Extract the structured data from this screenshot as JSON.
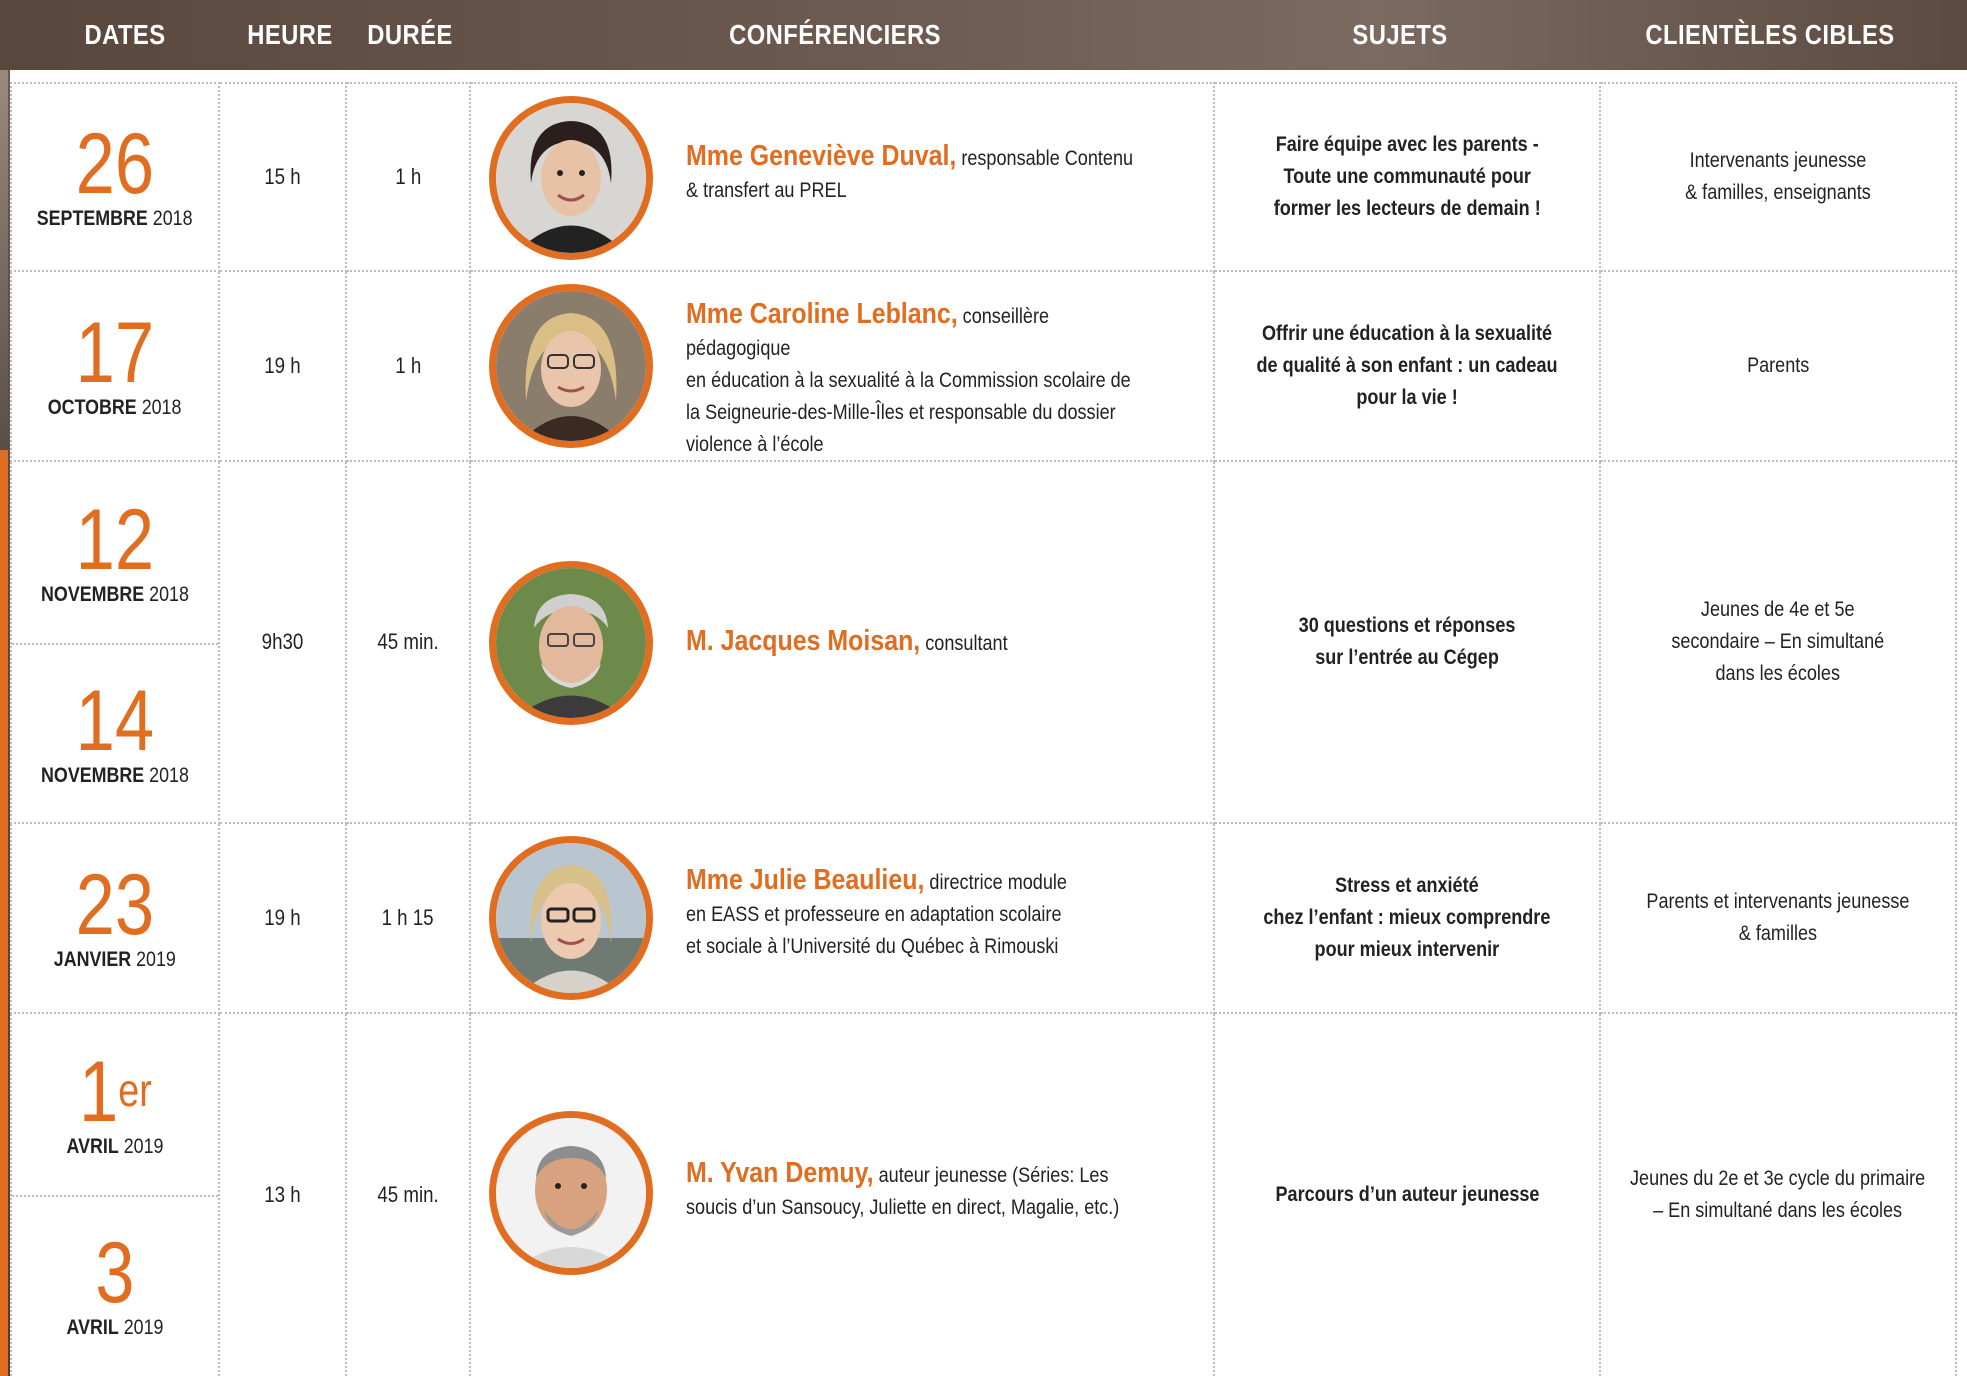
{
  "header": {
    "dates": "DATES",
    "heure": "HEURE",
    "duree": "DURÉE",
    "conferenciers": "CONFÉRENCIERS",
    "sujets": "SUJETS",
    "clienteles": "CLIENTÈLES CIBLES"
  },
  "colors": {
    "accent": "#e06d20",
    "header_bg": "#5f4d44"
  },
  "rows": [
    {
      "dates": [
        {
          "day": "26",
          "month": "SEPTEMBRE",
          "year": "2018"
        }
      ],
      "heure": "15 h",
      "duree": "1 h",
      "speaker_name": "Mme Geneviève Duval,",
      "speaker_role": "responsable Contenu",
      "speaker_role2": "& transfert au PREL",
      "subject_lines": [
        "Faire équipe avec les parents -",
        "Toute une communauté pour",
        "former  les lecteurs de demain !"
      ],
      "target_lines": [
        "Intervenants jeunesse",
        "& familles, enseignants"
      ]
    },
    {
      "dates": [
        {
          "day": "17",
          "month": "OCTOBRE",
          "year": "2018"
        }
      ],
      "heure": "19 h",
      "duree": "1 h",
      "speaker_name": "Mme Caroline Leblanc,",
      "speaker_role": "conseillère pédagogique",
      "speaker_role2": "en éducation à la sexualité à la Commission scolaire de",
      "speaker_role3": "la Seigneurie-des-Mille-Îles et responsable du dossier",
      "speaker_role4": "violence à l’école",
      "subject_lines": [
        "Offrir une éducation à la sexualité",
        "de qualité à son enfant : un cadeau",
        "pour la vie !"
      ],
      "target_lines": [
        "Parents"
      ]
    },
    {
      "dates": [
        {
          "day": "12",
          "month": "NOVEMBRE",
          "year": "2018"
        },
        {
          "day": "14",
          "month": "NOVEMBRE",
          "year": "2018"
        }
      ],
      "heure": "9h30",
      "duree": "45 min.",
      "speaker_name": "M. Jacques Moisan,",
      "speaker_role": "consultant",
      "subject_lines": [
        "30 questions et réponses",
        "sur l’entrée au Cégep"
      ],
      "target_lines": [
        "Jeunes de 4e et 5e",
        "secondaire – En simultané",
        "dans les écoles"
      ]
    },
    {
      "dates": [
        {
          "day": "23",
          "month": "JANVIER",
          "year": "2019"
        }
      ],
      "heure": "19 h",
      "duree": "1 h 15",
      "speaker_name": "Mme Julie Beaulieu,",
      "speaker_role": "directrice module",
      "speaker_role2": "en EASS et professeure en adaptation scolaire",
      "speaker_role3": "et sociale à l’Université du Québec à Rimouski",
      "subject_lines": [
        "Stress et anxiété",
        "chez l’enfant : mieux comprendre",
        "pour mieux intervenir"
      ],
      "target_lines": [
        "Parents et intervenants jeunesse",
        "& familles"
      ]
    },
    {
      "dates": [
        {
          "day": "1",
          "sup": "er",
          "month": "AVRIL",
          "year": "2019"
        },
        {
          "day": "3",
          "month": "AVRIL",
          "year": "2019"
        }
      ],
      "heure": "13 h",
      "duree": "45 min.",
      "speaker_name": "M. Yvan Demuy,",
      "speaker_role": "auteur jeunesse (Séries: Les",
      "speaker_role2": "soucis d’un Sansoucy, Juliette en direct, Magalie, etc.)",
      "subject_lines": [
        "Parcours d’un auteur jeunesse"
      ],
      "target_lines": [
        "Jeunes du 2e et 3e cycle du primaire",
        "– En simultané dans les écoles"
      ]
    }
  ]
}
